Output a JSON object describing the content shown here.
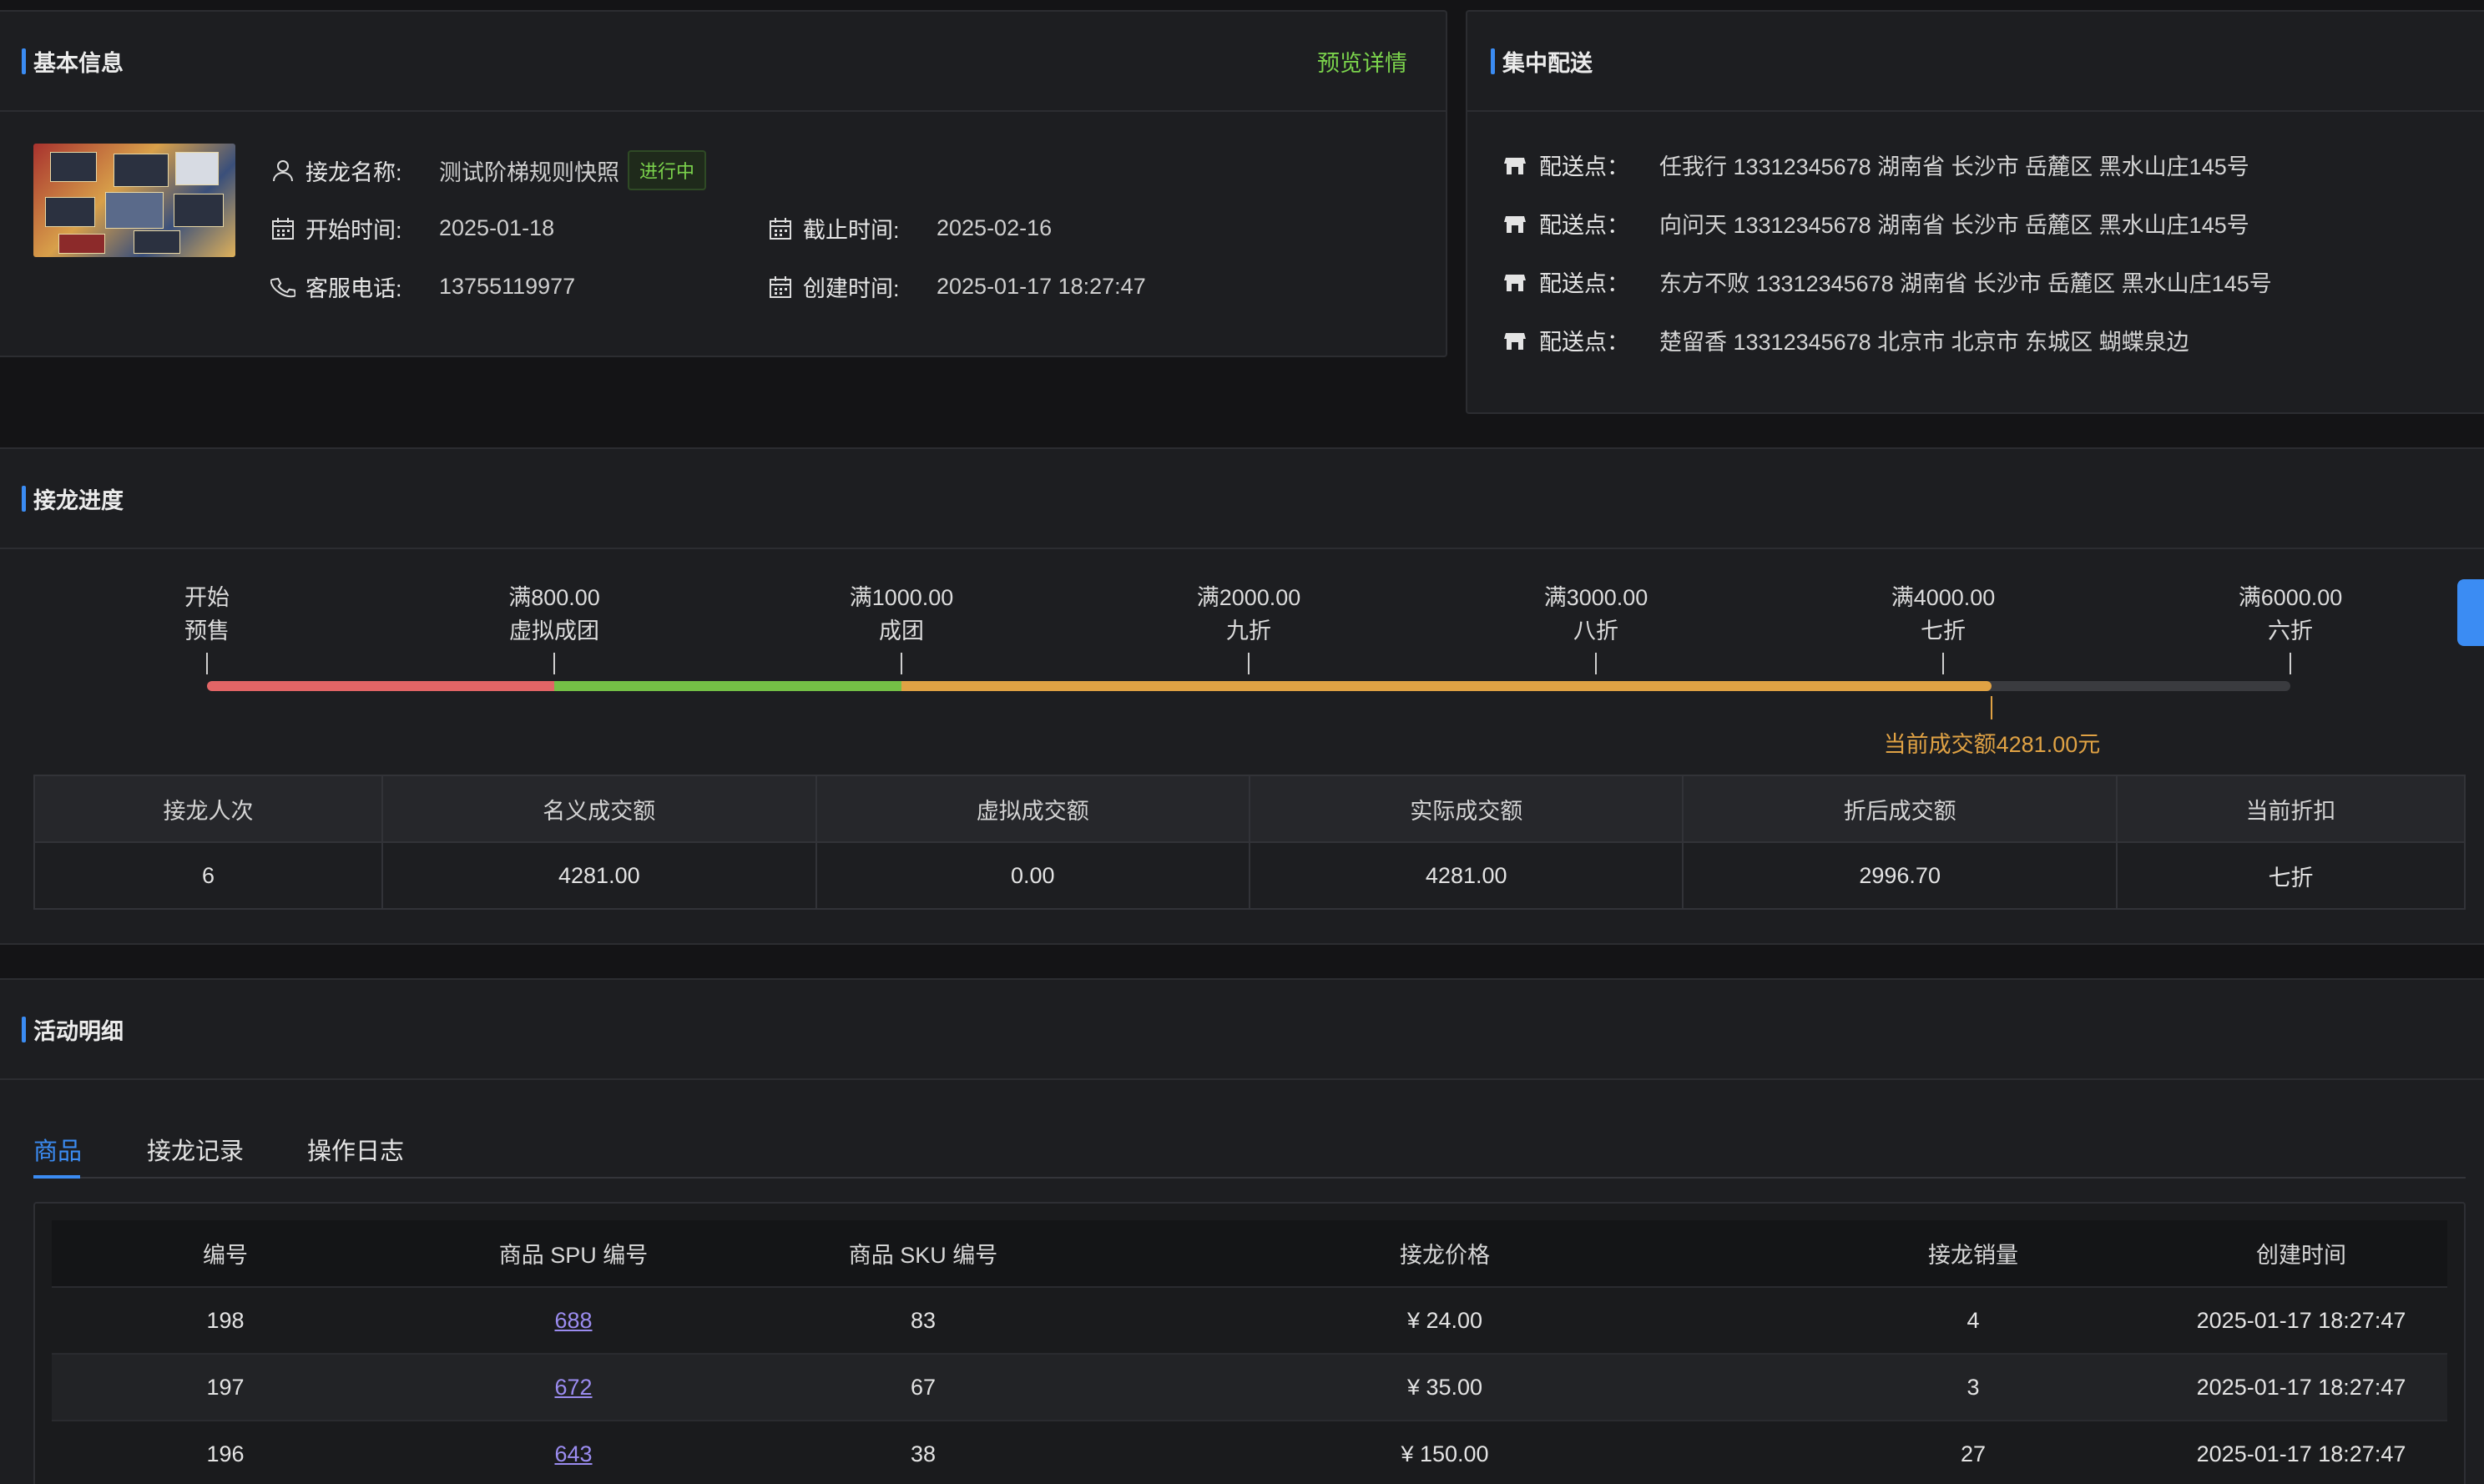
{
  "basic": {
    "title": "基本信息",
    "preview_link": "预览详情",
    "name_label": "接龙名称:",
    "name_value": "测试阶梯规则快照",
    "status_badge": "进行中",
    "start_label": "开始时间:",
    "start_value": "2025-01-18",
    "end_label": "截止时间:",
    "end_value": "2025-02-16",
    "phone_label": "客服电话:",
    "phone_value": "13755119977",
    "created_label": "创建时间:",
    "created_value": "2025-01-17 18:27:47"
  },
  "delivery": {
    "title": "集中配送",
    "label": "配送点：",
    "points": [
      "任我行 13312345678 湖南省 长沙市 岳麓区 黑水山庄145号",
      "向问天 13312345678 湖南省 长沙市 岳麓区 黑水山庄145号",
      "东方不败 13312345678 湖南省 长沙市 岳麓区 黑水山庄145号",
      "楚留香 13312345678 北京市 北京市 东城区 蝴蝶泉边"
    ]
  },
  "progress": {
    "title": "接龙进度",
    "milestones": [
      {
        "amount": "开始",
        "label": "预售"
      },
      {
        "amount": "满800.00",
        "label": "虚拟成团"
      },
      {
        "amount": "满1000.00",
        "label": "成团"
      },
      {
        "amount": "满2000.00",
        "label": "九折"
      },
      {
        "amount": "满3000.00",
        "label": "八折"
      },
      {
        "amount": "满4000.00",
        "label": "七折"
      },
      {
        "amount": "满6000.00",
        "label": "六折"
      }
    ],
    "segment_colors": [
      "#e26566",
      "#74c046",
      "#e0a244",
      "#e0a244",
      "#e0a244",
      "#e0a244"
    ],
    "current_amount": 4281,
    "current_text": "当前成交额4281.00元",
    "stats_headers": [
      "接龙人次",
      "名义成交额",
      "虚拟成交额",
      "实际成交额",
      "折后成交额",
      "当前折扣"
    ],
    "stats_values": [
      "6",
      "4281.00",
      "0.00",
      "4281.00",
      "2996.70",
      "七折"
    ]
  },
  "detail": {
    "title": "活动明细",
    "tabs": [
      "商品",
      "接龙记录",
      "操作日志"
    ],
    "active_tab": 0,
    "columns": [
      "编号",
      "商品 SPU 编号",
      "商品 SKU 编号",
      "接龙价格",
      "接龙销量",
      "创建时间"
    ],
    "rows": [
      [
        "198",
        "688",
        "83",
        "¥ 24.00",
        "4",
        "2025-01-17 18:27:47"
      ],
      [
        "197",
        "672",
        "67",
        "¥ 35.00",
        "3",
        "2025-01-17 18:27:47"
      ],
      [
        "196",
        "643",
        "38",
        "¥ 150.00",
        "27",
        "2025-01-17 18:27:47"
      ]
    ]
  }
}
